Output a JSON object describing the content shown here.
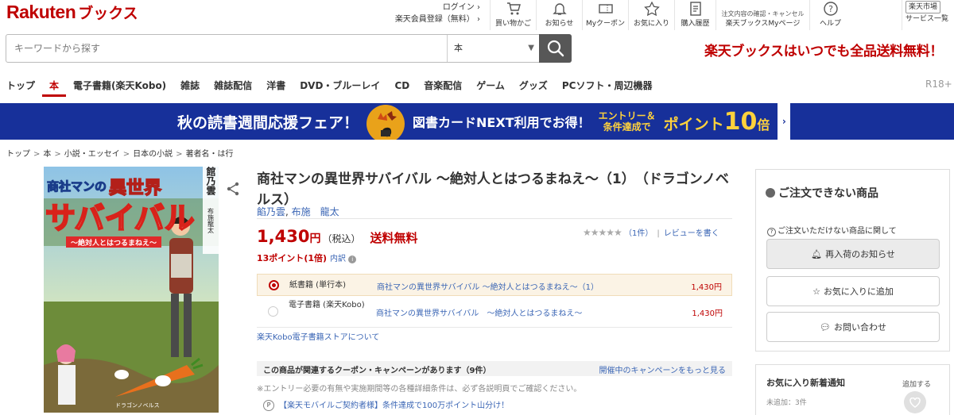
{
  "header": {
    "logo_brand": "Rakuten",
    "logo_sub": "ブックス",
    "login": "ログイン",
    "register": "楽天会員登録（無料）",
    "icons": [
      {
        "label": "買い物かご",
        "icon": "cart-icon"
      },
      {
        "label": "お知らせ",
        "icon": "bell-icon"
      },
      {
        "label": "Myクーポン",
        "icon": "coupon-icon"
      },
      {
        "label": "お気に入り",
        "icon": "star-icon"
      },
      {
        "label": "購入履歴",
        "icon": "history-icon"
      },
      {
        "label": "楽天ブックスMyページ",
        "label_top": "注文内容の確認・キャンセル",
        "icon": "user-icon"
      },
      {
        "label": "ヘルプ",
        "icon": "help-icon"
      }
    ],
    "marketplace": "楽天市場",
    "services": "サービス一覧"
  },
  "search": {
    "placeholder": "キーワードから探す",
    "category": "本"
  },
  "free_shipping": "楽天ブックスはいつでも全品送料無料！",
  "nav": {
    "items": [
      "トップ",
      "本",
      "電子書籍(楽天Kobo)",
      "雑誌",
      "雑誌配信",
      "洋書",
      "DVD・ブルーレイ",
      "CD",
      "音楽配信",
      "ゲーム",
      "グッズ",
      "PCソフト・周辺機器"
    ],
    "r18": "R18+"
  },
  "banner": {
    "text1": "秋の読書週間応援フェア！",
    "text2": "図書カードNEXT利用でお得！",
    "text3a": "エントリー＆",
    "text3b": "条件達成で",
    "text4": "ポイント",
    "text4_num": "10",
    "text4_unit": "倍"
  },
  "breadcrumb": [
    "トップ",
    "本",
    "小説・エッセイ",
    "日本の小説",
    "著者名・は行"
  ],
  "cover": {
    "title_top": "商社マンの",
    "title_main1": "異世界",
    "title_main2": "サバイバル",
    "subtitle": "〜絶対人とはつるまねえ〜",
    "author": "館乃雲",
    "illustrator": "布施龍太",
    "label": "ドラゴンノベルス"
  },
  "product": {
    "title": "商社マンの異世界サバイバル 〜絶対人とはつるまねえ〜（1）　（ドラゴンノベルス）",
    "author1": "餡乃雲",
    "author2": "布施　龍太",
    "price": "1,430",
    "yen": "円",
    "tax": "（税込）",
    "shipping": "送料無料",
    "stars": "★★★★★",
    "review_count": "（1件）",
    "write_review": "レビューを書く",
    "points": "13ポイント",
    "points_rate": "(1倍)",
    "points_detail": "内訳"
  },
  "formats": [
    {
      "type": "紙書籍 (単行本)",
      "name": "商社マンの異世界サバイバル 〜絶対人とはつるまねえ〜（1）",
      "price": "1,430円"
    },
    {
      "type": "電子書籍 (楽天Kobo)",
      "name": "商社マンの異世界サバイバル　〜絶対人とはつるまねえ〜",
      "price": "1,430円"
    }
  ],
  "kobo_link": "楽天Kobo電子書籍ストアについて",
  "coupon": {
    "heading": "この商品が関連するクーポン・キャンペーンがあります（9件）",
    "more": "開催中のキャンペーンをもっと見る",
    "note": "※エントリー必要の有無や実施期間等の各種詳細条件は、必ず各説明頁でご確認ください。",
    "campaign_icon": "P",
    "campaign": "【楽天モバイルご契約者様】条件達成で100万ポイント山分け！"
  },
  "order_panel": {
    "title": "ご注文できない商品",
    "note": "ご注文いただけない商品に関して",
    "restock": "再入荷のお知らせ",
    "favorite": "お気に入りに追加",
    "inquiry": "お問い合わせ"
  },
  "fav_panel": {
    "title": "お気に入り新着通知",
    "count": "未追加：3件",
    "add": "追加する"
  },
  "colors": {
    "brand_red": "#bf0000",
    "banner_blue": "#17309a",
    "link_blue": "#3b66b5",
    "banner_yellow": "#ffd23c"
  }
}
